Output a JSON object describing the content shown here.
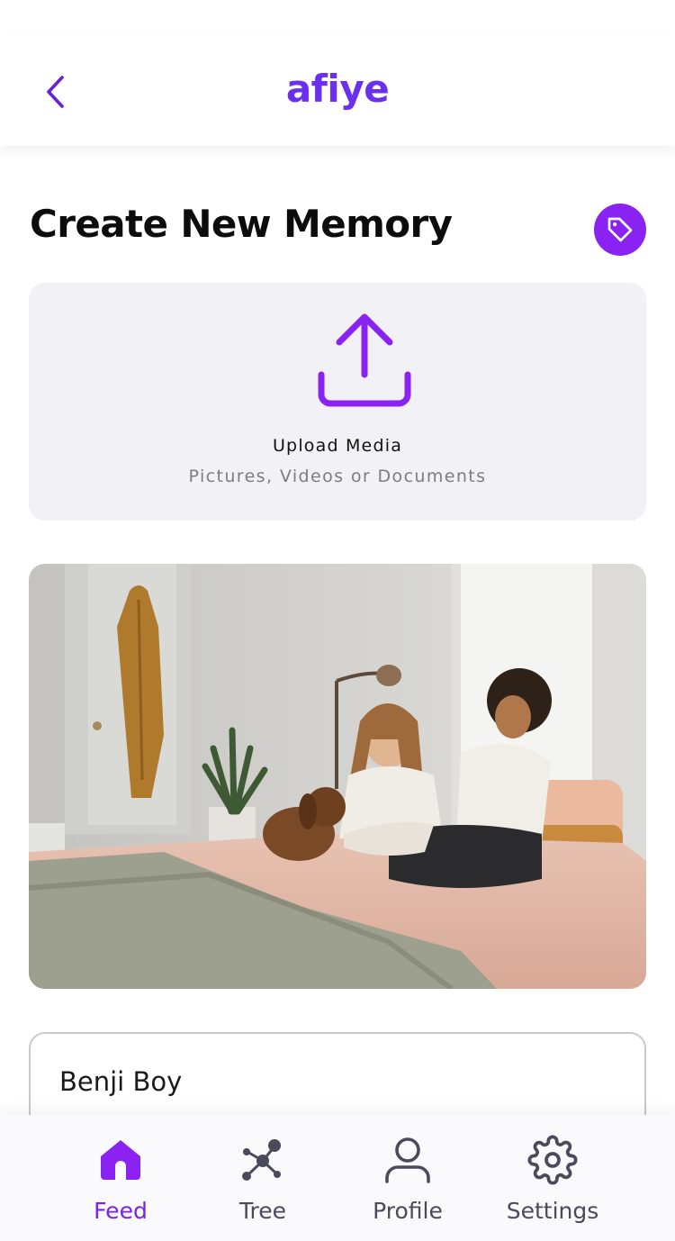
{
  "header": {
    "brand": "afiye",
    "back_icon": "chevron-left-icon"
  },
  "page": {
    "title": "Create New Memory",
    "tag_icon": "tag-icon"
  },
  "upload": {
    "icon": "upload-icon",
    "title": "Upload Media",
    "subtitle": "Pictures, Videos or Documents"
  },
  "memory": {
    "photo_description": "two-women-and-dog-on-bed-photo",
    "caption": "Benji Boy"
  },
  "nav": {
    "items": [
      {
        "label": "Feed",
        "icon": "home-icon",
        "active": true
      },
      {
        "label": "Tree",
        "icon": "tree-network-icon",
        "active": false
      },
      {
        "label": "Profile",
        "icon": "user-icon",
        "active": false
      },
      {
        "label": "Settings",
        "icon": "gear-icon",
        "active": false
      }
    ]
  },
  "colors": {
    "brand": "#6c2ff0",
    "accent": "#8a23f2",
    "card_bg": "#f1f1f6",
    "nav_inactive": "#4a4a5c"
  }
}
